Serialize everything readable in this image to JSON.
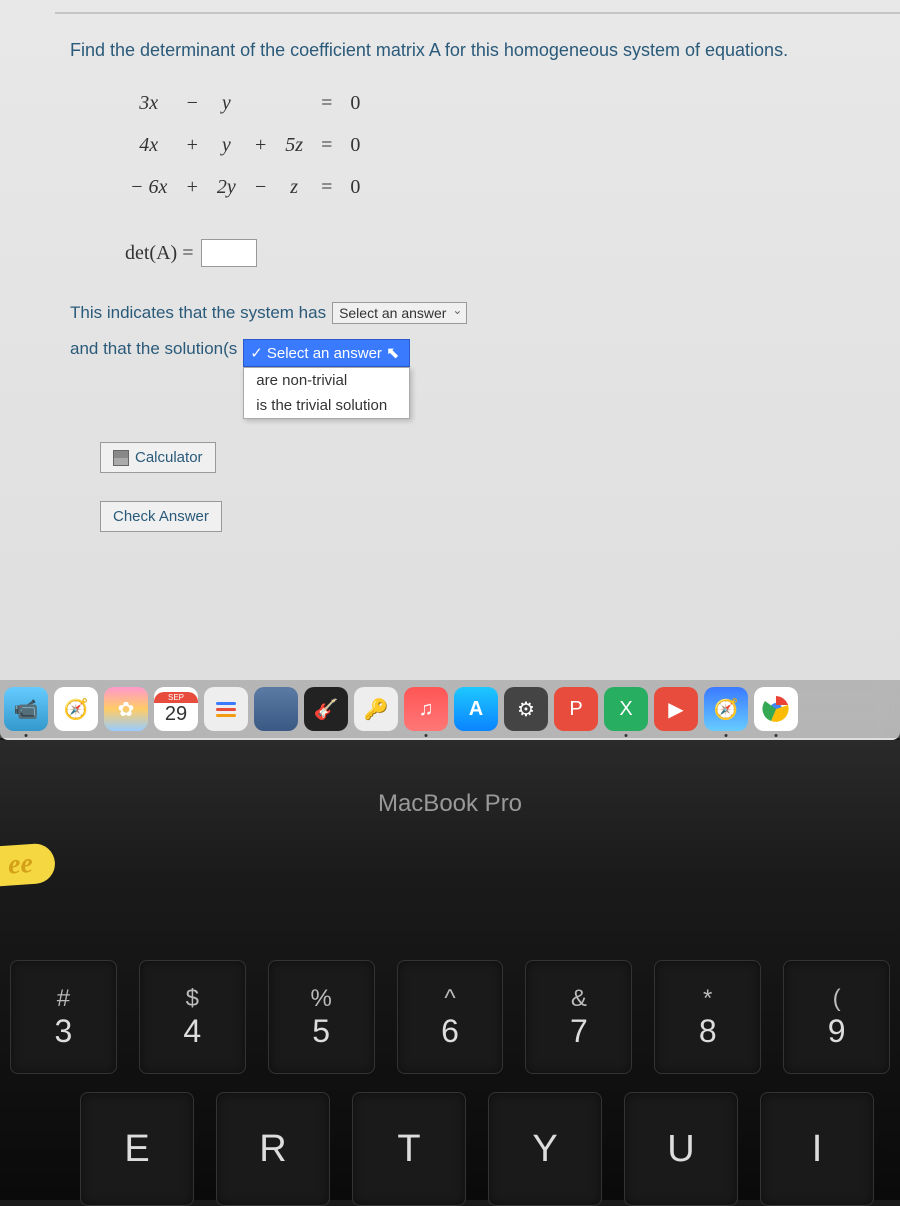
{
  "question": {
    "prompt": "Find the determinant of the coefficient matrix A for this homogeneous system of equations.",
    "equations": [
      [
        "3x",
        "−",
        "y",
        "",
        "",
        "=",
        "0"
      ],
      [
        "4x",
        "+",
        "y",
        "+",
        "5z",
        "=",
        "0"
      ],
      [
        "− 6x",
        "+",
        "2y",
        "−",
        "z",
        "=",
        "0"
      ]
    ],
    "det_label": "det(A) =",
    "det_value": "",
    "indicates_pre": "This indicates that the system has",
    "select1_placeholder": "Select an answer",
    "solution_pre": "and that the solution(s",
    "dropdown": {
      "selected": "Select an answer",
      "options": [
        "are non-trivial",
        "is the trivial solution"
      ]
    },
    "calculator_label": "Calculator",
    "check_label": "Check Answer"
  },
  "dock": {
    "calendar": {
      "month": "SEP",
      "day": "29"
    }
  },
  "laptop": {
    "label": "MacBook Pro",
    "sticker": "ee"
  },
  "keyboard": {
    "row1": [
      {
        "top": "#",
        "bot": "3"
      },
      {
        "top": "$",
        "bot": "4"
      },
      {
        "top": "%",
        "bot": "5"
      },
      {
        "top": "^",
        "bot": "6"
      },
      {
        "top": "&",
        "bot": "7"
      },
      {
        "top": "*",
        "bot": "8"
      },
      {
        "top": "(",
        "bot": "9"
      }
    ],
    "row2": [
      "E",
      "R",
      "T",
      "Y",
      "U",
      "I"
    ]
  }
}
